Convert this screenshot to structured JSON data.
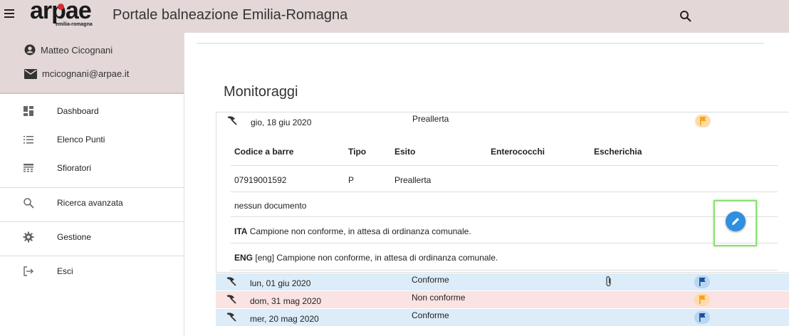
{
  "header": {
    "logo_text": "arpae",
    "logo_subtext": "emilia-romagna",
    "title": "Portale balneazione Emilia-Romagna"
  },
  "user": {
    "name": "Matteo Cicognani",
    "email": "mcicognani@arpae.it"
  },
  "sidebar": {
    "items": [
      {
        "label": "Dashboard",
        "icon": "dashboard-icon"
      },
      {
        "label": "Elenco Punti",
        "icon": "list-icon"
      },
      {
        "label": "Sfioratori",
        "icon": "sfioratori-icon"
      },
      {
        "label": "Ricerca avanzata",
        "icon": "search-icon"
      },
      {
        "label": "Gestione",
        "icon": "gear-icon"
      },
      {
        "label": "Esci",
        "icon": "logout-icon"
      }
    ]
  },
  "main": {
    "heading": "Monitoraggi",
    "monitoraggi": [
      {
        "date": "gio, 18 giu 2020",
        "esito": "Preallerta",
        "flag": "orange",
        "row_color": "#ffffff",
        "attachment": false
      },
      {
        "date": "lun, 01 giu 2020",
        "esito": "Conforme",
        "flag": "blue",
        "row_color": "#dcecf8",
        "attachment": true
      },
      {
        "date": "dom, 31 mag 2020",
        "esito": "Non conforme",
        "flag": "orange",
        "row_color": "#fbe3e3",
        "attachment": false
      },
      {
        "date": "mer, 20 mag 2020",
        "esito": "Conforme",
        "flag": "blue",
        "row_color": "#dcecf8",
        "attachment": false
      }
    ],
    "detail": {
      "headers": [
        "Codice a barre",
        "Tipo",
        "Esito",
        "Enterococchi",
        "Escherichia"
      ],
      "row": [
        "07919001592",
        "P",
        "Preallerta",
        "",
        ""
      ],
      "documents": "nessun documento",
      "ita_label": "ITA",
      "ita_text": "Campione non conforme, in attesa di ordinanza comunale.",
      "eng_label": "ENG",
      "eng_text": "[eng] Campione non conforme, in attesa di ordinanza comunale."
    }
  },
  "colors": {
    "header_bg": "#e3d7d8",
    "flag_orange": "#f7a21b",
    "flag_blue": "#1c4f9c",
    "flag_orange_bg": "#fcdcaa",
    "flag_blue_bg": "#b8d6f2",
    "edit_button": "#2e8ee0",
    "highlight": "#8fde77"
  }
}
